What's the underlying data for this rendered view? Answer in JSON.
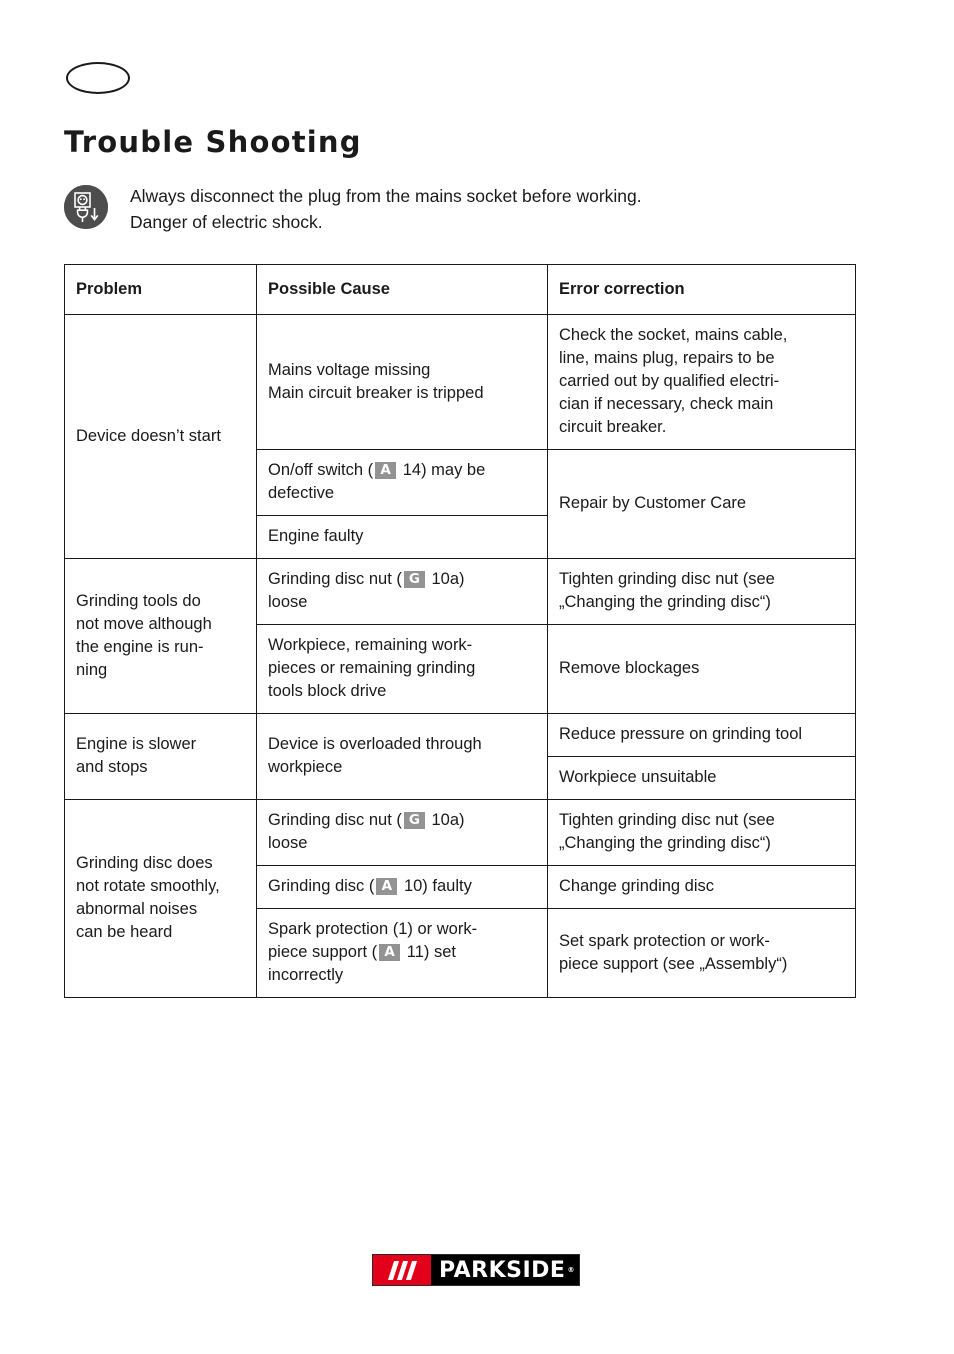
{
  "header": {
    "lang_badge": "",
    "title": "Trouble Shooting"
  },
  "warning": {
    "icon": "disconnect-mains-plug-icon",
    "line1": "Always disconnect the plug from the mains socket before working.",
    "line2": "Danger of electric shock."
  },
  "table": {
    "columns": [
      "Problem",
      "Possible Cause",
      "Error correction"
    ],
    "rows": [
      {
        "problem": "Device doesn’t start",
        "causes": [
          {
            "text_lines": [
              "Mains voltage missing",
              "Main circuit breaker is tripped"
            ],
            "correction_lines": [
              "Check the socket, mains cable,",
              "line, mains plug, repairs to be",
              "carried out by qualified electri-",
              "cian if necessary, check main",
              "circuit breaker."
            ]
          },
          {
            "text_prefix": "On/off switch (",
            "ref": "A",
            "text_suffix": " 14) may be defective",
            "correction_lines": [
              "Repair by Customer Care"
            ]
          },
          {
            "text_lines": [
              "Engine faulty"
            ],
            "correction_lines": []
          }
        ]
      },
      {
        "problem": "Grinding tools do not move although the engine is running",
        "causes": [
          {
            "text_prefix": "Grinding disc nut (",
            "ref": "G",
            "text_suffix": " 10a) loose",
            "correction_lines": [
              "Tighten grinding disc nut (see",
              "„Changing the grinding disc“)"
            ]
          },
          {
            "text_lines": [
              "Workpiece, remaining work-",
              "pieces or remaining grinding",
              "tools block drive"
            ],
            "correction_lines": [
              "Remove blockages"
            ]
          }
        ]
      },
      {
        "problem": "Engine is slower and stops",
        "causes": [
          {
            "text_lines": [
              "Device is overloaded through",
              "workpiece"
            ],
            "correction_lines": [
              "Reduce pressure on grinding tool"
            ]
          },
          {
            "text_lines": [],
            "correction_lines": [
              "Workpiece unsuitable"
            ]
          }
        ]
      },
      {
        "problem": "Grinding disc does not rotate smoothly, abnormal noises can be heard",
        "causes": [
          {
            "text_prefix": "Grinding disc nut (",
            "ref": "G",
            "text_suffix": " 10a) loose",
            "correction_lines": [
              "Tighten grinding disc nut (see",
              "„Changing the grinding disc“)"
            ]
          },
          {
            "text_prefix": "Grinding disc (",
            "ref": "A",
            "text_suffix": " 10) faulty",
            "correction_lines": [
              "Change grinding disc"
            ]
          },
          {
            "text_prefix": "Spark protection (1) or work-piece support (",
            "ref": "A",
            "text_suffix": " 11) set incorrectly",
            "correction_lines": [
              "Set spark protection or work-",
              "piece support (see „Assembly“)"
            ]
          }
        ]
      }
    ]
  },
  "cells": {
    "r1_problem": "Device doesn’t start",
    "r1c1_l1": "Mains voltage missing",
    "r1c1_l2": "Main circuit breaker is tripped",
    "r1e1_l1": "Check the socket, mains cable,",
    "r1e1_l2": "line, mains plug, repairs to be",
    "r1e1_l3": "carried out by qualified electri-",
    "r1e1_l4": "cian if necessary, check main",
    "r1e1_l5": "circuit breaker.",
    "r1c2_pre": "On/off switch (",
    "r1c2_ref": "A",
    "r1c2_post": " 14) may be",
    "r1c2_post2": "defective",
    "r1e2": "Repair by Customer Care",
    "r1c3": "Engine faulty",
    "r2_problem_l1": "Grinding tools do",
    "r2_problem_l2": "not move although",
    "r2_problem_l3": "the engine is run-",
    "r2_problem_l4": "ning",
    "r2c1_pre": "Grinding disc nut (",
    "r2c1_ref": "G",
    "r2c1_post": " 10a)",
    "r2c1_post2": "loose",
    "r2e1_l1": "Tighten grinding disc nut (see",
    "r2e1_l2": "„Changing the grinding disc“)",
    "r2c2_l1": "Workpiece, remaining work-",
    "r2c2_l2": "pieces or remaining grinding",
    "r2c2_l3": "tools block drive",
    "r2e2": "Remove blockages",
    "r3_problem_l1": "Engine is slower",
    "r3_problem_l2": "and stops",
    "r3c1_l1": "Device is overloaded through",
    "r3c1_l2": "workpiece",
    "r3e1": "Reduce pressure on grinding tool",
    "r3e2": "Workpiece unsuitable",
    "r4_problem_l1": "Grinding disc does",
    "r4_problem_l2": "not rotate smoothly,",
    "r4_problem_l3": "abnormal noises",
    "r4_problem_l4": "can be heard",
    "r4c1_pre": "Grinding disc nut (",
    "r4c1_ref": "G",
    "r4c1_post": " 10a)",
    "r4c1_post2": "loose",
    "r4e1_l1": "Tighten grinding disc nut (see",
    "r4e1_l2": "„Changing the grinding disc“)",
    "r4c2_pre": "Grinding disc (",
    "r4c2_ref": "A",
    "r4c2_post": " 10) faulty",
    "r4e2": "Change grinding disc",
    "r4c3_pre": "Spark protection (1) or work-",
    "r4c3_pre2": "piece support (",
    "r4c3_ref": "A",
    "r4c3_post": " 11) set",
    "r4c3_post2": "incorrectly",
    "r4e3_l1": "Set spark protection or work-",
    "r4e3_l2": "piece support (see „Assembly“)"
  },
  "footer": {
    "logo_brand": "PARKSIDE",
    "logo_registered": "®",
    "logo_red": "#e3001b",
    "logo_black": "#000000"
  },
  "colors": {
    "text": "#1a1a1a",
    "rule": "#1a1a1a",
    "ref_badge_bg": "#939393",
    "warning_icon_bg": "#4d4d4d"
  }
}
